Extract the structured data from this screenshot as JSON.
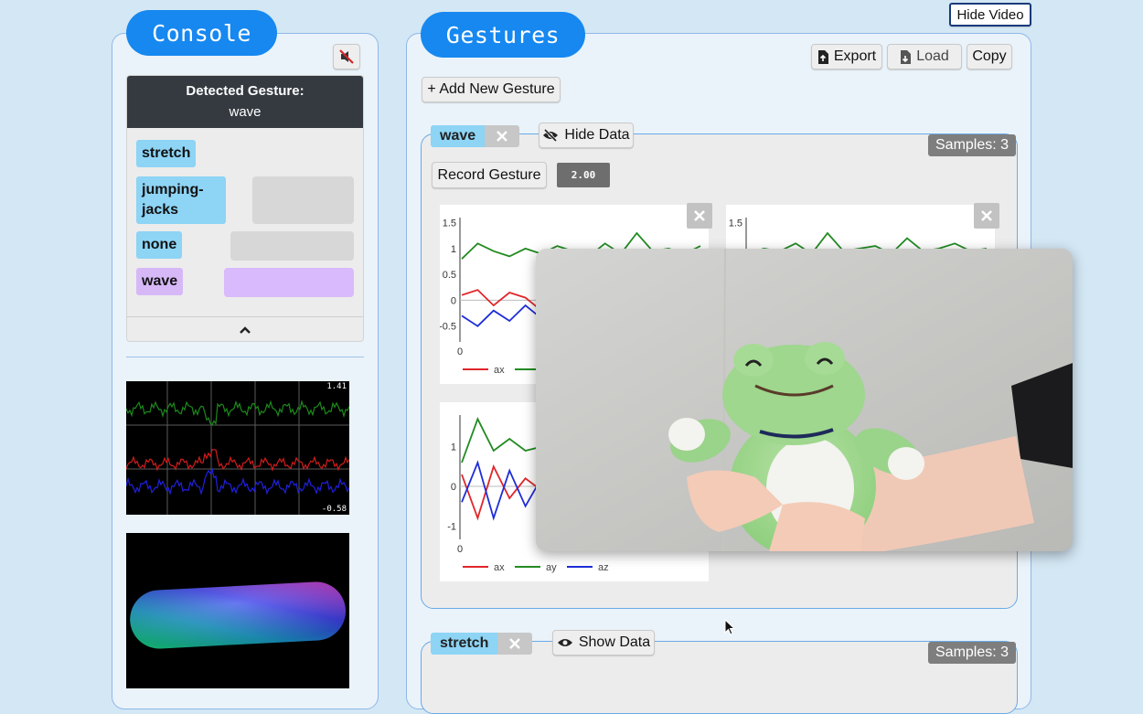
{
  "header": {
    "hide_video_label": "Hide Video"
  },
  "console": {
    "title": "Console",
    "detected_heading": "Detected Gesture:",
    "detected_value": "wave",
    "gesture_tags": [
      {
        "label": "stretch",
        "score_fraction": 0.0
      },
      {
        "label": "jumping-\njacks",
        "score_fraction": 0.85
      },
      {
        "label": "none",
        "score_fraction": 0.6
      },
      {
        "label": "wave",
        "score_fraction": 1.0,
        "active": true
      }
    ],
    "sensor_plot": {
      "max_label": "1.41",
      "min_label": "-0.58"
    }
  },
  "gestures": {
    "title": "Gestures",
    "export_label": "Export",
    "load_label": "Load",
    "copy_label": "Copy",
    "add_label": "+ Add New Gesture",
    "cards": [
      {
        "name": "wave",
        "toggle_label": "Hide Data",
        "samples_label": "Samples: 3",
        "record_label": "Record Gesture",
        "duration_value": "2.00"
      },
      {
        "name": "stretch",
        "toggle_label": "Show Data",
        "samples_label": "Samples: 3"
      }
    ]
  },
  "chart_data": [
    {
      "type": "line",
      "yticks": [
        "1.5",
        "1",
        "0.5",
        "0",
        "-0.5"
      ],
      "xticks": [
        "0"
      ],
      "legend": [
        "ax",
        "ay",
        "az"
      ],
      "series": [
        {
          "name": "ax",
          "color": "#e0262b",
          "values": [
            0.1,
            0.2,
            -0.1,
            0.15,
            0.05,
            -0.2,
            0.1,
            0.2,
            -0.05,
            0.1,
            -0.1,
            0.15,
            0.0,
            -0.15,
            0.1,
            0.05
          ]
        },
        {
          "name": "ay",
          "color": "#228b22",
          "values": [
            0.8,
            1.1,
            0.95,
            0.85,
            1.0,
            0.9,
            1.05,
            0.95,
            0.85,
            1.1,
            0.9,
            1.3,
            0.95,
            1.0,
            0.9,
            1.05
          ]
        },
        {
          "name": "az",
          "color": "#1e2ed8",
          "values": [
            -0.3,
            -0.5,
            -0.2,
            -0.4,
            -0.1,
            -0.35,
            -0.2,
            -0.45,
            -0.3,
            -0.1,
            -0.4,
            -0.25,
            -0.5,
            -0.3,
            -0.2,
            -0.4
          ]
        }
      ]
    },
    {
      "type": "line",
      "yticks": [
        "1.5"
      ],
      "series": [
        {
          "name": "ay",
          "color": "#228b22",
          "values": [
            0.9,
            1.0,
            0.95,
            1.1,
            0.9,
            1.3,
            0.95,
            1.0,
            1.05,
            0.9,
            1.2,
            0.95,
            1.0,
            1.1,
            0.95,
            1.0
          ]
        }
      ]
    },
    {
      "type": "line",
      "yticks": [
        "1",
        "0",
        "-1"
      ],
      "xticks": [
        "0"
      ],
      "legend": [
        "ax",
        "ay",
        "az"
      ],
      "series": [
        {
          "name": "ax",
          "color": "#e0262b",
          "values": [
            0.3,
            -0.8,
            0.5,
            -0.3,
            0.2,
            -0.1,
            0.15,
            0.0,
            0.1,
            -0.05,
            0.1,
            0.0,
            -0.1,
            0.05,
            0.0,
            0.05
          ]
        },
        {
          "name": "ay",
          "color": "#228b22",
          "values": [
            0.6,
            1.7,
            0.9,
            1.2,
            0.9,
            1.0,
            0.85,
            1.0,
            0.9,
            0.95,
            0.85,
            0.9,
            1.0,
            0.9,
            0.95,
            0.9
          ]
        },
        {
          "name": "az",
          "color": "#1e2ed8",
          "values": [
            -0.4,
            0.6,
            -0.8,
            0.4,
            -0.5,
            0.2,
            -0.3,
            0.1,
            -0.2,
            0.0,
            -0.15,
            0.05,
            -0.1,
            0.0,
            -0.05,
            -0.1
          ]
        }
      ]
    }
  ]
}
